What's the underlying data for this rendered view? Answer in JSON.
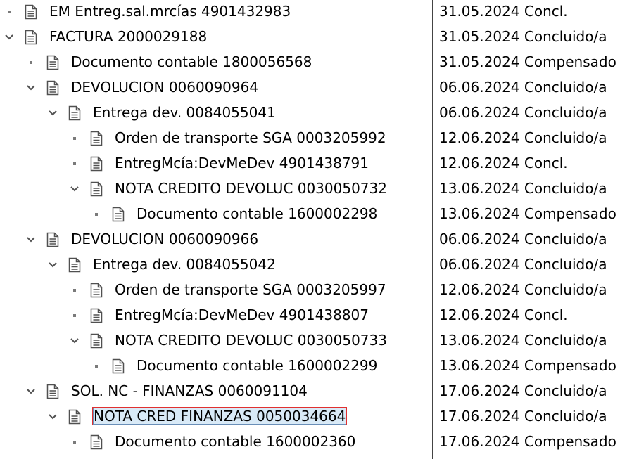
{
  "tree": {
    "rows": [
      {
        "depth": 0,
        "toggle": "leaf",
        "label": "EM Entreg.sal.mrcías 4901432983",
        "date": "31.05.2024",
        "status": "Concl."
      },
      {
        "depth": 0,
        "toggle": "open",
        "label": "FACTURA 2000029188",
        "date": "31.05.2024",
        "status": "Concluido/a"
      },
      {
        "depth": 1,
        "toggle": "leaf",
        "label": "Documento contable 1800056568",
        "date": "31.05.2024",
        "status": "Compensado"
      },
      {
        "depth": 1,
        "toggle": "open",
        "label": "DEVOLUCION 0060090964",
        "date": "06.06.2024",
        "status": "Concluido/a"
      },
      {
        "depth": 2,
        "toggle": "open",
        "label": "Entrega dev. 0084055041",
        "date": "06.06.2024",
        "status": "Concluido/a"
      },
      {
        "depth": 3,
        "toggle": "leaf",
        "label": "Orden de transporte SGA 0003205992",
        "date": "12.06.2024",
        "status": "Concluido/a"
      },
      {
        "depth": 3,
        "toggle": "leaf",
        "label": "EntregMcía:DevMeDev 4901438791",
        "date": "12.06.2024",
        "status": "Concl."
      },
      {
        "depth": 3,
        "toggle": "open",
        "label": "NOTA CREDITO DEVOLUC 0030050732",
        "date": "13.06.2024",
        "status": "Concluido/a"
      },
      {
        "depth": 4,
        "toggle": "leaf",
        "label": "Documento contable 1600002298",
        "date": "13.06.2024",
        "status": "Compensado"
      },
      {
        "depth": 1,
        "toggle": "open",
        "label": "DEVOLUCION 0060090966",
        "date": "06.06.2024",
        "status": "Concluido/a"
      },
      {
        "depth": 2,
        "toggle": "open",
        "label": "Entrega dev. 0084055042",
        "date": "06.06.2024",
        "status": "Concluido/a"
      },
      {
        "depth": 3,
        "toggle": "leaf",
        "label": "Orden de transporte SGA 0003205997",
        "date": "12.06.2024",
        "status": "Concluido/a"
      },
      {
        "depth": 3,
        "toggle": "leaf",
        "label": "EntregMcía:DevMeDev 4901438807",
        "date": "12.06.2024",
        "status": "Concl."
      },
      {
        "depth": 3,
        "toggle": "open",
        "label": "NOTA CREDITO DEVOLUC 0030050733",
        "date": "13.06.2024",
        "status": "Concluido/a"
      },
      {
        "depth": 4,
        "toggle": "leaf",
        "label": "Documento contable 1600002299",
        "date": "13.06.2024",
        "status": "Compensado"
      },
      {
        "depth": 1,
        "toggle": "open",
        "label": "SOL. NC - FINANZAS 0060091104",
        "date": "17.06.2024",
        "status": "Concluido/a"
      },
      {
        "depth": 2,
        "toggle": "open",
        "label": "NOTA CRED FINANZAS 0050034664",
        "date": "17.06.2024",
        "status": "Concluido/a",
        "selected": true
      },
      {
        "depth": 3,
        "toggle": "leaf",
        "label": "Documento contable 1600002360",
        "date": "17.06.2024",
        "status": "Compensado"
      }
    ]
  }
}
